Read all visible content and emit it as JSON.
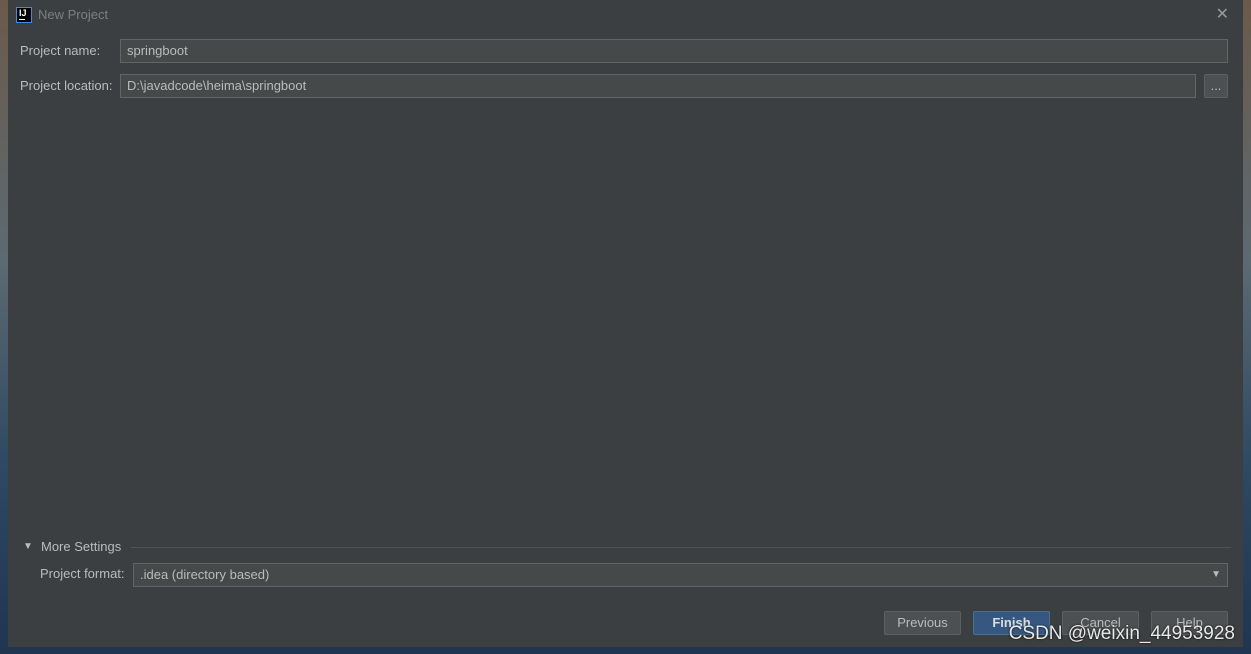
{
  "window": {
    "title": "New Project",
    "logo_text": "IJ"
  },
  "form": {
    "name_label": "Project name:",
    "name_value": "springboot",
    "location_label": "Project location:",
    "location_value": "D:\\javadcode\\heima\\springboot",
    "browse_label": "..."
  },
  "more_settings": {
    "label": "More Settings",
    "format_label": "Project format:",
    "format_value": ".idea (directory based)"
  },
  "buttons": {
    "previous": "Previous",
    "finish": "Finish",
    "cancel": "Cancel",
    "help": "Help"
  },
  "watermark": "CSDN @weixin_44953928"
}
